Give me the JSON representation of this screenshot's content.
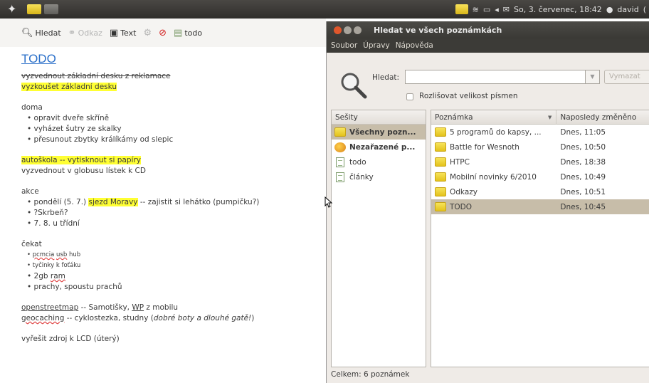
{
  "top_panel": {
    "clock": "So, 3. červenec, 18:42",
    "user": "david",
    "tray_last": "("
  },
  "note_window": {
    "toolbar": {
      "search": "Hledat",
      "link": "Odkaz",
      "text": "Text",
      "notebook": "todo"
    },
    "title": "TODO",
    "struck_line": "vyzvednout základní desku z reklamace",
    "hl_line": "vyzkoušet základní desku",
    "doma_heading": "doma",
    "doma_items": [
      "opravit dveře skříně",
      "vyházet šutry ze skalky",
      "přesunout zbytky králíkámy od slepic"
    ],
    "autoskola_hl": "autoškola -- vytisknout si papíry",
    "autoskola_line": "vyzvednout v globusu lístek k CD",
    "akce_heading": "akce",
    "akce_item1_pre": "pondělí (5. 7.) ",
    "akce_item1_hl": "sjezd Moravy",
    "akce_item1_post": " -- zajistit si lehátko (pumpičku?)",
    "akce_item2": "?Skrbeň?",
    "akce_item3": "7. 8. u třídní",
    "cekat_heading": "čekat",
    "cekat_item1_a": "pcmcia",
    "cekat_item1_b": "usb",
    "cekat_item1_c": "hub",
    "cekat_item2": "tyčinky k foťáku",
    "cekat_item3_a": "2gb",
    "cekat_item3_b": "ram",
    "cekat_item4": "prachy, spoustu prachů",
    "osm_a": "openstreetmap",
    "osm_b": " -- Samotišky, ",
    "osm_c": "WP",
    "osm_d": " z mobilu",
    "geo_a": "geocaching",
    "geo_b": " -- cyklostezka, studny (",
    "geo_c": "dobré boty a dlouhé gatě!",
    "geo_d": ")",
    "last_line": "vyřešit zdroj k LCD (úterý)"
  },
  "search_window": {
    "title": "Hledat ve všech poznámkách",
    "menu": [
      "Soubor",
      "Úpravy",
      "Nápověda"
    ],
    "search_label": "Hledat:",
    "search_value": "",
    "clear_button": "Vymazat",
    "case_label": "Rozlišovat velikost písmen",
    "notebooks_header": "Sešity",
    "notebooks": [
      {
        "label": "Všechny pozn...",
        "icon": "folder",
        "bold": true,
        "selected": true
      },
      {
        "label": "Nezařazené p...",
        "icon": "mixed",
        "bold": true,
        "selected": false
      },
      {
        "label": "todo",
        "icon": "page",
        "bold": false,
        "selected": false
      },
      {
        "label": "články",
        "icon": "page",
        "bold": false,
        "selected": false
      }
    ],
    "notes_header_title": "Poznámka",
    "notes_header_date": "Naposledy změněno",
    "notes": [
      {
        "title": "5 programů do kapsy, ...",
        "date": "Dnes, 11:05"
      },
      {
        "title": "Battle for Wesnoth",
        "date": "Dnes, 10:50"
      },
      {
        "title": "HTPC",
        "date": "Dnes, 18:38"
      },
      {
        "title": "Mobilní novinky 6/2010",
        "date": "Dnes, 10:49"
      },
      {
        "title": "Odkazy",
        "date": "Dnes, 10:51"
      },
      {
        "title": "TODO",
        "date": "Dnes, 10:45"
      }
    ],
    "status": "Celkem: 6 poznámek"
  },
  "colors": {
    "title_link": "#2a6fc9",
    "highlight": "#ffff33",
    "selection": "#c7bda9",
    "panel": "#3c3b37"
  }
}
